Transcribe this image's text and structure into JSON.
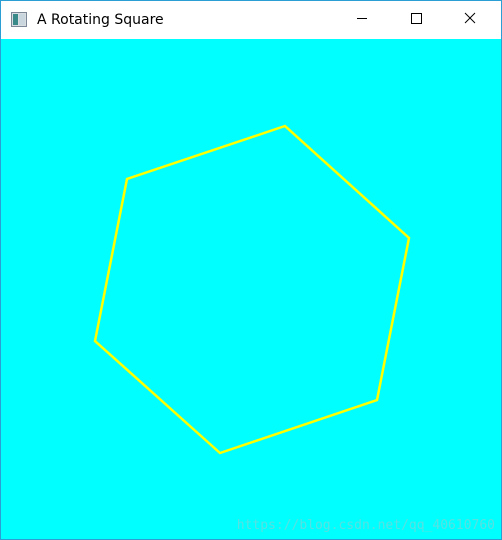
{
  "window": {
    "title": "A Rotating Square",
    "icon": "app-window-icon",
    "controls": {
      "minimize_icon": "minimize-icon",
      "maximize_icon": "maximize-icon",
      "close_icon": "close-icon"
    }
  },
  "canvas": {
    "background_color": "#00ffff",
    "shape": {
      "kind": "hexagon",
      "stroke_color": "#ffff00"
    },
    "watermark": "https://blog.csdn.net/qq_40610760"
  }
}
